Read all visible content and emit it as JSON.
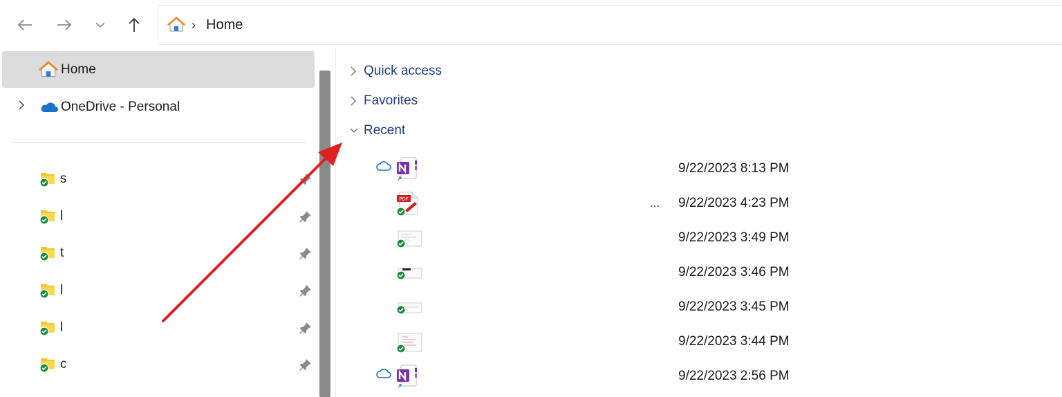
{
  "nav": {
    "back_icon": "arrow-left-icon",
    "forward_icon": "arrow-right-icon",
    "recent_icon": "chevron-down-icon",
    "up_icon": "arrow-up-icon"
  },
  "address": {
    "icon": "home-icon",
    "separator": "›",
    "crumb": "Home"
  },
  "sidebar": {
    "home_label": "Home",
    "onedrive_label": "OneDrive - Personal",
    "pinned": [
      {
        "label": "s",
        "pinned": true
      },
      {
        "label": "l",
        "pinned": true
      },
      {
        "label": "t",
        "pinned": true
      },
      {
        "label": "l",
        "pinned": true
      },
      {
        "label": "l",
        "pinned": true
      },
      {
        "label": "c",
        "pinned": true
      }
    ]
  },
  "main": {
    "sections": [
      {
        "label": "Quick access",
        "expanded": false
      },
      {
        "label": "Favorites",
        "expanded": false
      },
      {
        "label": "Recent",
        "expanded": true
      }
    ],
    "recent_files": [
      {
        "type": "onenote",
        "cloud": true,
        "date": "9/22/2023 8:13 PM"
      },
      {
        "type": "pdf",
        "synced": true,
        "ellipsis": "...",
        "date": "9/22/2023 4:23 PM"
      },
      {
        "type": "doc",
        "synced": true,
        "date": "9/22/2023 3:49 PM"
      },
      {
        "type": "doc",
        "synced": true,
        "date": "9/22/2023 3:46 PM"
      },
      {
        "type": "doc",
        "synced": true,
        "date": "9/22/2023 3:45 PM"
      },
      {
        "type": "doc",
        "synced": true,
        "date": "9/22/2023 3:44 PM"
      },
      {
        "type": "onenote",
        "cloud": true,
        "date": "9/22/2023 2:56 PM"
      }
    ]
  },
  "colors": {
    "section_text": "#1f3b86",
    "selected_bg": "#dcdcdc",
    "annotation_arrow": "#e02020",
    "folder": "#f7c52b",
    "sync_check": "#1a8a3a",
    "onenote": "#7b2fa8",
    "cloud": "#1a73c8"
  }
}
